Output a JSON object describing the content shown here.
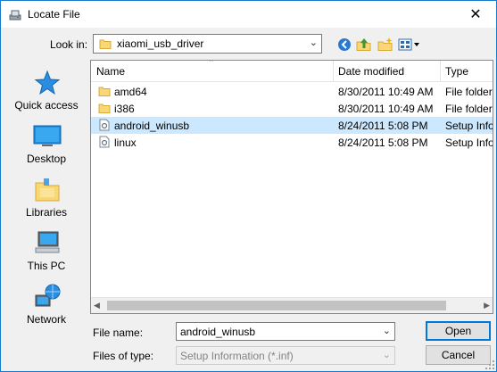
{
  "window": {
    "title": "Locate File",
    "close_glyph": "✕"
  },
  "toolbar": {
    "look_in_label": "Look in:",
    "look_in_value": "xiaomi_usb_driver",
    "icons": [
      "back-icon",
      "up-folder-icon",
      "new-folder-icon",
      "view-menu-icon"
    ]
  },
  "places": [
    {
      "label": "Quick access",
      "icon": "star-icon"
    },
    {
      "label": "Desktop",
      "icon": "desktop-icon"
    },
    {
      "label": "Libraries",
      "icon": "libraries-icon"
    },
    {
      "label": "This PC",
      "icon": "pc-icon"
    },
    {
      "label": "Network",
      "icon": "network-icon"
    }
  ],
  "list": {
    "columns": [
      "Name",
      "Date modified",
      "Type"
    ],
    "rows": [
      {
        "name": "amd64",
        "date": "8/30/2011 10:49 AM",
        "type": "File folder",
        "icon": "folder-icon",
        "selected": false
      },
      {
        "name": "i386",
        "date": "8/30/2011 10:49 AM",
        "type": "File folder",
        "icon": "folder-icon",
        "selected": false
      },
      {
        "name": "android_winusb",
        "date": "8/24/2011 5:08 PM",
        "type": "Setup Information",
        "icon": "inf-file-icon",
        "selected": true
      },
      {
        "name": "linux",
        "date": "8/24/2011 5:08 PM",
        "type": "Setup Information",
        "icon": "inf-file-icon",
        "selected": false
      }
    ]
  },
  "footer": {
    "file_name_label": "File name:",
    "file_name_value": "android_winusb",
    "file_type_label": "Files of type:",
    "file_type_value": "Setup Information (*.inf)",
    "open_label": "Open",
    "cancel_label": "Cancel"
  },
  "colors": {
    "accent": "#0078d7",
    "selection": "#cce8ff",
    "folder": "#f8d775"
  }
}
